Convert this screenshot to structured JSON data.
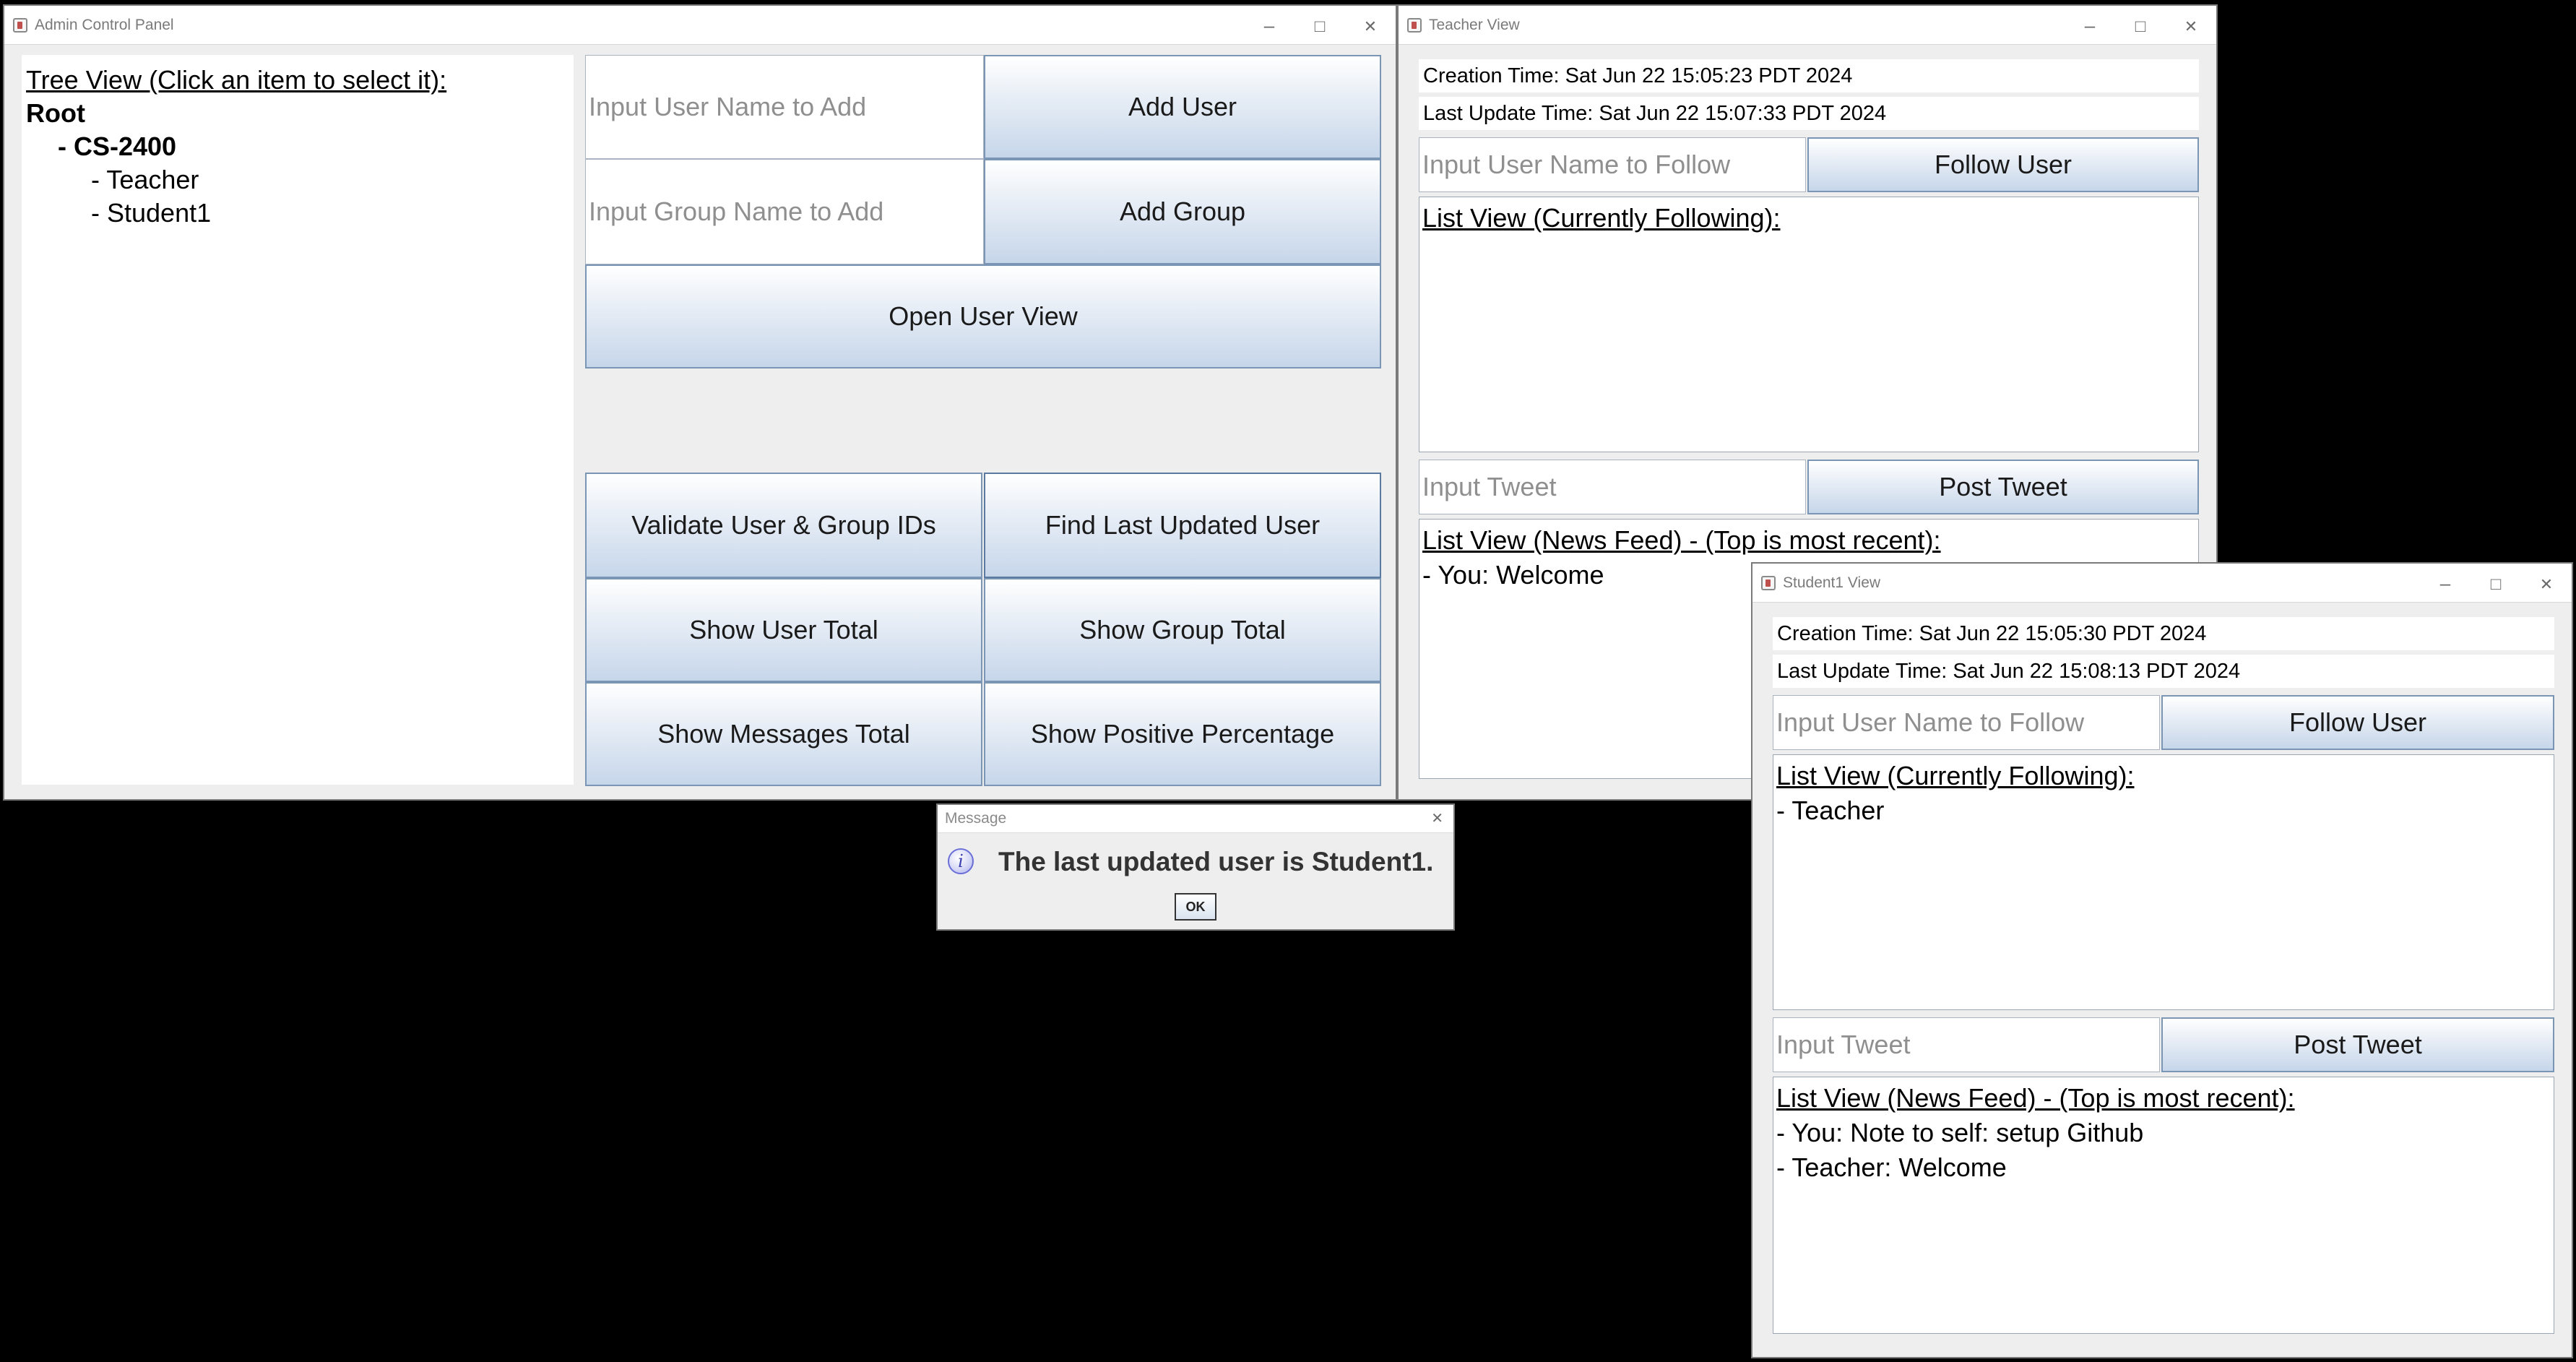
{
  "admin": {
    "title": "Admin Control Panel",
    "tree_heading": "Tree View (Click an item to select it):",
    "tree": {
      "root": "Root",
      "group": "- CS-2400",
      "users": [
        "- Teacher",
        "- Student1"
      ]
    },
    "user_name_placeholder": "Input User Name to Add",
    "add_user_label": "Add User",
    "group_name_placeholder": "Input Group Name to Add",
    "add_group_label": "Add Group",
    "open_user_view_label": "Open User View",
    "validate_label": "Validate User & Group IDs",
    "find_last_label": "Find Last Updated User",
    "show_user_total_label": "Show User Total",
    "show_group_total_label": "Show Group Total",
    "show_messages_total_label": "Show Messages Total",
    "show_positive_label": "Show Positive Percentage"
  },
  "teacher_view": {
    "title": "Teacher View",
    "creation_time": "Creation Time: Sat Jun 22 15:05:23 PDT 2024",
    "last_update_time": "Last Update Time: Sat Jun 22 15:07:33 PDT 2024",
    "follow_placeholder": "Input User Name to Follow",
    "follow_label": "Follow User",
    "following_heading": "List View (Currently Following):",
    "following": [],
    "tweet_placeholder": "Input Tweet",
    "post_label": "Post Tweet",
    "feed_heading": "List View (News Feed) - (Top is most recent):",
    "feed": [
      "- You: Welcome"
    ]
  },
  "student_view": {
    "title": "Student1 View",
    "creation_time": "Creation Time: Sat Jun 22 15:05:30 PDT 2024",
    "last_update_time": "Last Update Time: Sat Jun 22 15:08:13 PDT 2024",
    "follow_placeholder": "Input User Name to Follow",
    "follow_label": "Follow User",
    "following_heading": "List View (Currently Following):",
    "following": [
      "- Teacher"
    ],
    "tweet_placeholder": "Input Tweet",
    "post_label": "Post Tweet",
    "feed_heading": "List View (News Feed) - (Top is most recent):",
    "feed": [
      "- You: Note to self: setup Github",
      "- Teacher: Welcome"
    ]
  },
  "message_dialog": {
    "title": "Message",
    "text": "The last updated user is Student1.",
    "ok_label": "OK",
    "icon": "info-icon",
    "icon_color": "#6a6fd8"
  },
  "colors": {
    "button_gradient_bottom": "#c6d6ea",
    "button_border": "#7b95b5",
    "window_bg": "#eeeeee",
    "desktop_bg": "#000000"
  }
}
